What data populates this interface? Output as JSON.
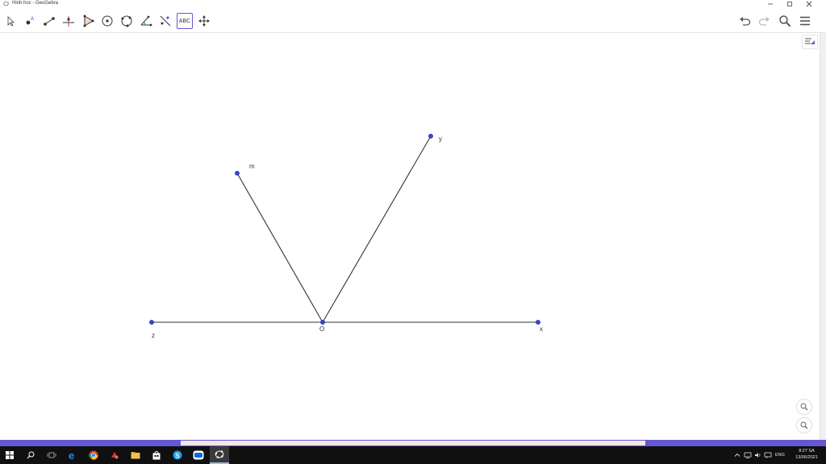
{
  "window": {
    "title": "Hinh hoc - GeoGebra"
  },
  "toolbar": {
    "tools": [
      {
        "name": "move-tool",
        "icon": "arrow-cursor-icon"
      },
      {
        "name": "point-tool",
        "icon": "point-icon"
      },
      {
        "name": "segment-tool",
        "icon": "segment-icon"
      },
      {
        "name": "perpendicular-line-tool",
        "icon": "perpendicular-icon"
      },
      {
        "name": "polygon-tool",
        "icon": "polygon-icon"
      },
      {
        "name": "circle-tool",
        "icon": "circle-center-point-icon"
      },
      {
        "name": "circle-three-points-tool",
        "icon": "circle-three-points-icon"
      },
      {
        "name": "angle-tool",
        "icon": "angle-icon"
      },
      {
        "name": "reflect-tool",
        "icon": "reflect-line-icon"
      },
      {
        "name": "text-tool",
        "icon": "text-abc-icon",
        "label": "ABC",
        "selected": true
      },
      {
        "name": "move-graphics-view-tool",
        "icon": "move-view-icon"
      }
    ],
    "right": [
      "undo-icon",
      "redo-icon",
      "search-icon",
      "menu-icon"
    ]
  },
  "graphics": {
    "points": {
      "O": {
        "label": "O"
      },
      "x": {
        "label": "x"
      },
      "y": {
        "label": "y"
      },
      "z": {
        "label": "z"
      },
      "m": {
        "label": "m"
      }
    },
    "point_color": "#3a44d6",
    "line_color": "#333333"
  },
  "taskbar": {
    "apps": [
      "windows-start-icon",
      "search-icon",
      "task-view-icon",
      "edge-icon",
      "chrome-icon",
      "app-red-icon",
      "file-explorer-icon",
      "store-icon",
      "skype-icon",
      "zalo-icon",
      "geogebra-icon"
    ],
    "tray_language": "ENG",
    "time": "8:27 SA",
    "date": "13/06/2021"
  },
  "colors": {
    "accent": "#6557d2",
    "taskbar": "#101010"
  }
}
